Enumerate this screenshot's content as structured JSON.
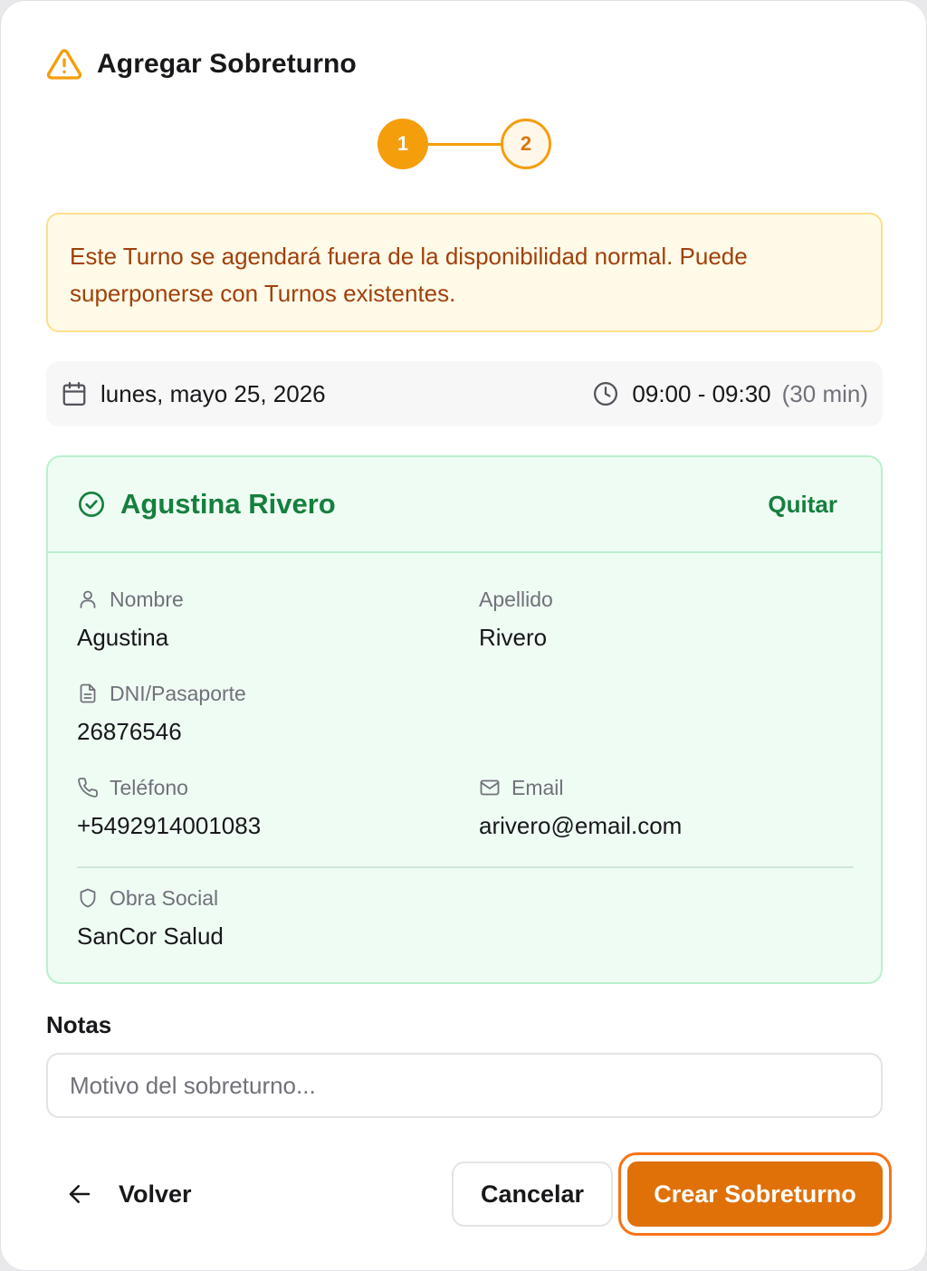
{
  "dialog": {
    "title": "Agregar Sobreturno",
    "icon": "warning-triangle-icon",
    "accent_color": "#f59e0b"
  },
  "stepper": {
    "steps": [
      {
        "label": "1",
        "state": "active"
      },
      {
        "label": "2",
        "state": "upcoming"
      }
    ]
  },
  "warning": {
    "message": "Este Turno se agendará fuera de la disponibilidad normal. Puede superponerse con Turnos existentes."
  },
  "schedule": {
    "date": "lunes, mayo 25, 2026",
    "time_range": "09:00 - 09:30",
    "duration": "(30 min)"
  },
  "patient": {
    "full_name": "Agustina Rivero",
    "remove_label": "Quitar",
    "status_color": "#15803d",
    "fields": {
      "first_name": {
        "label": "Nombre",
        "value": "Agustina"
      },
      "last_name": {
        "label": "Apellido",
        "value": "Rivero"
      },
      "document": {
        "label": "DNI/Pasaporte",
        "value": "26876546"
      },
      "phone": {
        "label": "Teléfono",
        "value": "+5492914001083"
      },
      "email": {
        "label": "Email",
        "value": "arivero@email.com"
      },
      "insurance": {
        "label": "Obra Social",
        "value": "SanCor Salud"
      }
    }
  },
  "notes": {
    "label": "Notas",
    "value": "",
    "placeholder": "Motivo del sobreturno..."
  },
  "footer": {
    "back_label": "Volver",
    "cancel_label": "Cancelar",
    "create_label": "Crear Sobreturno",
    "create_color": "#e07008"
  }
}
